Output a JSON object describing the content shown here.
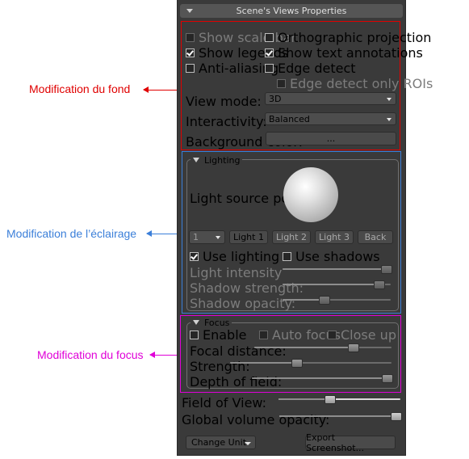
{
  "annotations": {
    "fond": {
      "text": "Modification du fond",
      "color": "#e00000"
    },
    "eclairage": {
      "text": "Modification de l’éclairage",
      "color": "#3b7fd9"
    },
    "focus": {
      "text": "Modification du focus",
      "color": "#e000d8"
    }
  },
  "panel": {
    "title": "Scene's Views Properties",
    "background": {
      "show_scale_bar": {
        "label": "Show scale bar",
        "checked": false,
        "enabled": false
      },
      "orthographic_projection": {
        "label": "Orthographic projection",
        "checked": false
      },
      "show_legends": {
        "label": "Show legends",
        "checked": true
      },
      "show_text_annotations": {
        "label": "Show text annotations",
        "checked": true
      },
      "anti_aliasing": {
        "label": "Anti-aliasing",
        "checked": false
      },
      "edge_detect": {
        "label": "Edge detect",
        "checked": false
      },
      "edge_detect_only_rois": {
        "label": "Edge detect only ROIs",
        "checked": false,
        "enabled": false
      },
      "view_mode": {
        "label": "View mode:",
        "value": "3D"
      },
      "interactivity": {
        "label": "Interactivity:",
        "value": "Balanced"
      },
      "background_color": {
        "label": "Background color:",
        "button": "..."
      }
    },
    "lighting": {
      "title": "Lighting",
      "light_source_position": "Light source position:",
      "light_select": "1",
      "buttons": [
        "Light 1",
        "Light 2",
        "Light 3",
        "Back"
      ],
      "use_lighting": {
        "label": "Use lighting",
        "checked": true
      },
      "use_shadows": {
        "label": "Use shadows",
        "checked": false
      },
      "light_intensity": {
        "label": "Light intensity",
        "value": 1.0
      },
      "shadow_strength": {
        "label": "Shadow strength:",
        "value": 0.89
      },
      "shadow_opacity": {
        "label": "Shadow opacity:",
        "value": 0.38
      }
    },
    "focus": {
      "title": "Focus",
      "enable": {
        "label": "Enable",
        "checked": false
      },
      "auto_focus": {
        "label": "Auto focus",
        "checked": false,
        "enabled": false
      },
      "close_up": {
        "label": "Close up",
        "checked": false,
        "enabled": false
      },
      "focal_distance": {
        "label": "Focal distance:",
        "value": 0.72
      },
      "strength": {
        "label": "Strength:",
        "value": 0.41
      },
      "depth_of_field": {
        "label": "Depth of field:",
        "value": 0.97
      }
    },
    "field_of_view": {
      "label": "Field of View:",
      "value": 0.42
    },
    "global_volume_opacity": {
      "label": "Global volume opacity:",
      "value": 0.97
    },
    "change_unit": "Change Unit",
    "export_screenshot": "Export Screenshot..."
  }
}
